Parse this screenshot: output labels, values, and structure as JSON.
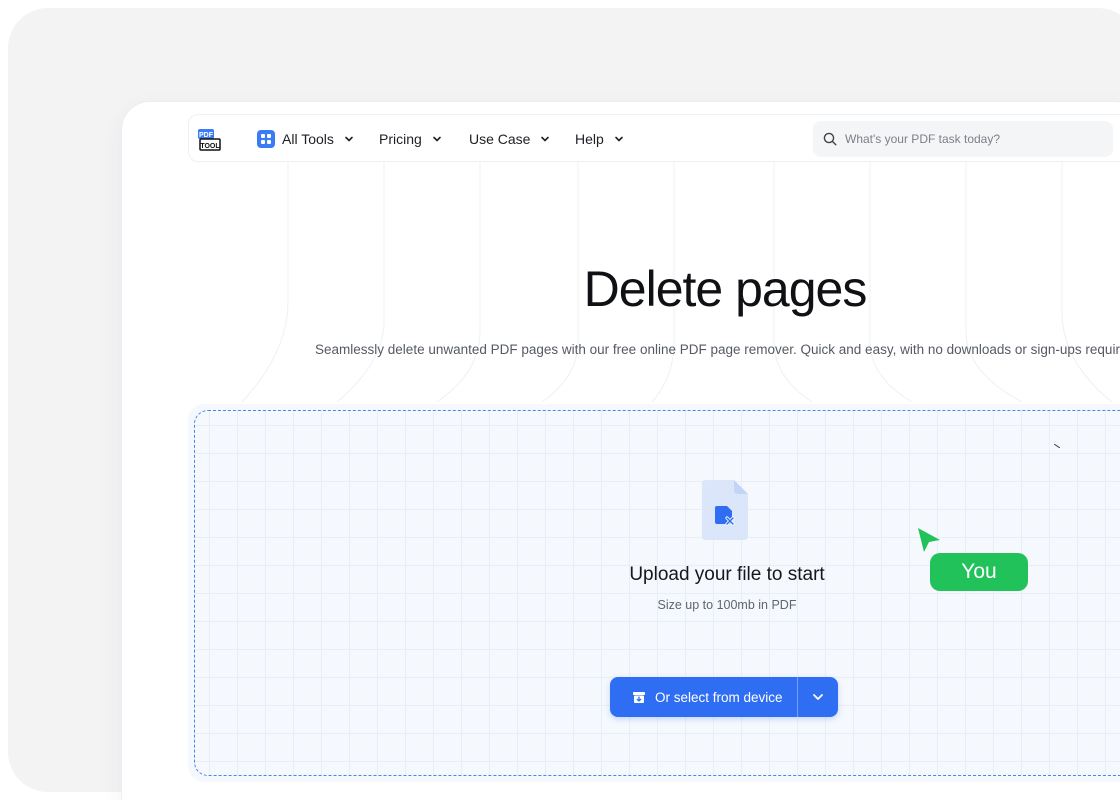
{
  "nav": {
    "logo_text_top": "PDF",
    "logo_text_bottom": "TOOL",
    "items": [
      {
        "label": "All Tools",
        "icon": "grid-icon"
      },
      {
        "label": "Pricing"
      },
      {
        "label": "Use Case"
      },
      {
        "label": "Help"
      }
    ],
    "search_placeholder": "What's your PDF task today?"
  },
  "hero": {
    "title": "Delete pages",
    "subtitle": "Seamlessly delete unwanted PDF pages with our free online PDF page remover. Quick and easy, with no downloads or sign-ups required"
  },
  "upload": {
    "title": "Upload your file to start",
    "subtitle": "Size up to 100mb in PDF",
    "button_label": "Or select from device",
    "cursor_label": "You"
  },
  "colors": {
    "accent": "#2f6ef2",
    "you_badge": "#22c25a",
    "file_icon": "#dbe6fb"
  }
}
